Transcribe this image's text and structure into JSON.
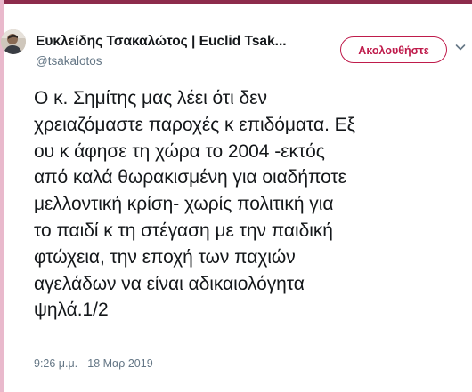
{
  "accent_color": "#bf1b4b",
  "tweet": {
    "author": {
      "display_name": "Ευκλείδης Τσακαλώτος | Euclid Tsak...",
      "handle": "@tsakalotos",
      "avatar_icon": "profile-photo"
    },
    "follow_button_label": "Ακολουθήστε",
    "menu_icon": "chevron-down-icon",
    "text_lines": [
      "Ο κ. Σημίτης μας λέει ότι δεν",
      "χρειαζόμαστε παροχές κ επιδόματα. Εξ",
      "ου κ άφησε τη χώρα το 2004 -εκτός",
      "από καλά θωρακισμένη για οιαδήποτε",
      "μελλοντική κρίση- χωρίς πολιτική για",
      "το παιδί κ τη στέγαση με την παιδική",
      "φτώχεια, την εποχή των παχιών",
      "αγελάδων να είναι αδικαιολόγητα",
      "ψηλά.1/2"
    ],
    "timestamp": "9:26 μ.μ. - 18 Μαρ 2019"
  }
}
